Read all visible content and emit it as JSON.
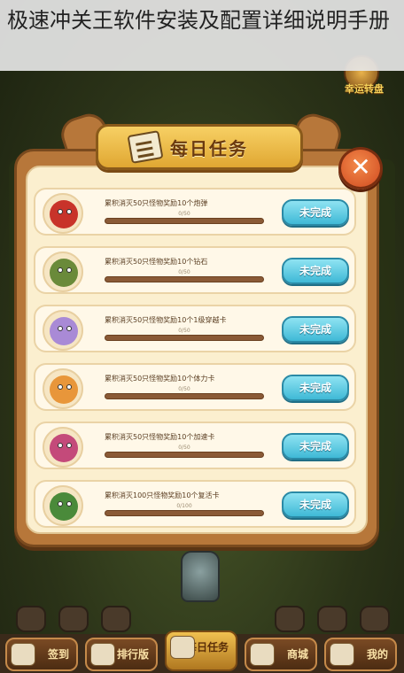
{
  "article_title": "极速冲关王软件安装及配置详细说明手册",
  "top_right": {
    "wheel_label": "幸运转盘"
  },
  "dialog": {
    "title": "每日任务",
    "close_label": "✕",
    "tasks": [
      {
        "text": "累积消灭50只怪物奖励10个炮弹",
        "progress": "0/50",
        "button": "未完成",
        "avatar_color": "#c8332a"
      },
      {
        "text": "累积消灭50只怪物奖励10个钻石",
        "progress": "0/50",
        "button": "未完成",
        "avatar_color": "#6a8a3a"
      },
      {
        "text": "累积消灭50只怪物奖励10个1级穿越卡",
        "progress": "0/50",
        "button": "未完成",
        "avatar_color": "#a98ad6"
      },
      {
        "text": "累积消灭50只怪物奖励10个体力卡",
        "progress": "0/50",
        "button": "未完成",
        "avatar_color": "#e8963a"
      },
      {
        "text": "累积消灭50只怪物奖励10个加速卡",
        "progress": "0/50",
        "button": "未完成",
        "avatar_color": "#c44a7a"
      },
      {
        "text": "累积消灭100只怪物奖励10个复活卡",
        "progress": "0/100",
        "button": "未完成",
        "avatar_color": "#4a8a3a"
      }
    ]
  },
  "bottom_nav": [
    {
      "label": "签到"
    },
    {
      "label": "排行版"
    },
    {
      "label": "每日任务"
    },
    {
      "label": "商城"
    },
    {
      "label": "我的"
    }
  ]
}
